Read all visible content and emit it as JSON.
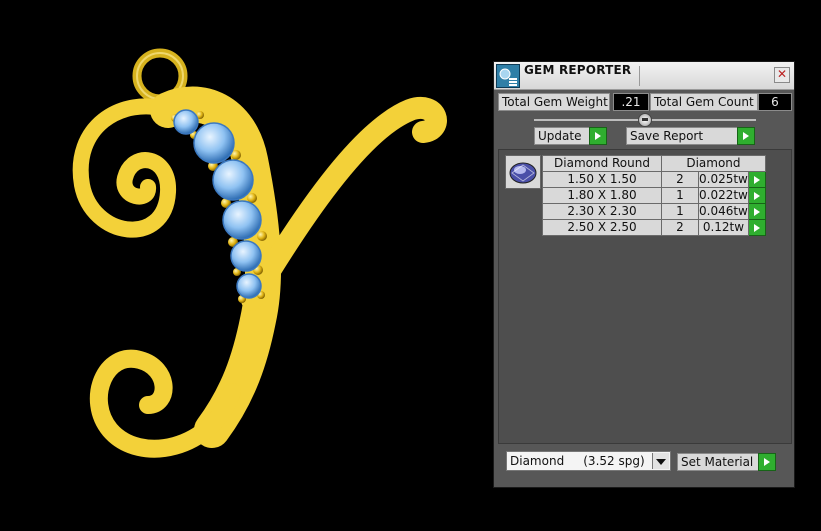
{
  "window": {
    "title": "GEM REPORTER"
  },
  "summary": {
    "total_gem_weight_label": "Total Gem Weight",
    "total_gem_weight_value": ".21",
    "total_gem_count_label": "Total Gem Count",
    "total_gem_count_value": "6"
  },
  "buttons": {
    "update": "Update",
    "save_report": "Save Report",
    "set_material": "Set Material"
  },
  "gem_table": {
    "shape_header": "Diamond Round",
    "material_header": "Diamond",
    "rows": [
      {
        "size": "1.50 X 1.50",
        "count": "2",
        "weight": "0.025tw"
      },
      {
        "size": "1.80 X 1.80",
        "count": "1",
        "weight": "0.022tw"
      },
      {
        "size": "2.30 X 2.30",
        "count": "1",
        "weight": "0.046tw"
      },
      {
        "size": "2.50 X 2.50",
        "count": "2",
        "weight": "0.12tw"
      }
    ]
  },
  "material": {
    "selected": "Diamond     (3.52 spg)"
  },
  "colors": {
    "panel_bg": "#575757",
    "metal_gold": "#f3d139",
    "gem_blue": "#8fc2f2",
    "go_button": "#2fae2f"
  }
}
